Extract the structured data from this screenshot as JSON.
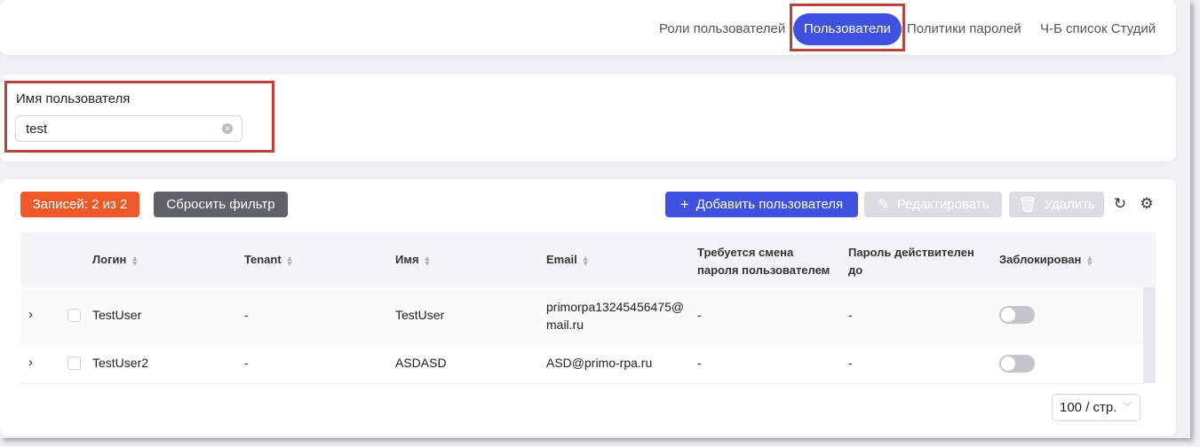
{
  "tabs": [
    {
      "label": "Роли пользователей",
      "active": false
    },
    {
      "label": "Пользователи",
      "active": true
    },
    {
      "label": "Политики паролей",
      "active": false
    },
    {
      "label": "Ч-Б список Студий",
      "active": false
    }
  ],
  "filter": {
    "label": "Имя пользователя",
    "value": "test"
  },
  "toolbar": {
    "count_label": "Записей: 2 из 2",
    "reset_label": "Сбросить фильтр",
    "add_label": "Добавить пользователя",
    "edit_label": "Редактировать",
    "delete_label": "Удалить",
    "add_icon": "plus-icon",
    "edit_icon": "pencil-icon",
    "delete_icon": "trash-icon",
    "refresh_icon": "refresh-icon",
    "settings_icon": "gear-icon"
  },
  "table": {
    "headers": {
      "login": "Логин",
      "tenant": "Tenant",
      "name": "Имя",
      "email": "Email",
      "pwd_change_1": "Требуется смена",
      "pwd_change_2": "пароля пользователем",
      "pwd_valid_1": "Пароль действителен",
      "pwd_valid_2": "до",
      "blocked": "Заблокирован"
    },
    "rows": [
      {
        "login": "TestUser",
        "tenant": "-",
        "name": "TestUser",
        "email_1": "primorpa13245456475@",
        "email_2": "mail.ru",
        "pwd_change": "-",
        "pwd_valid": "-",
        "blocked": false
      },
      {
        "login": "TestUser2",
        "tenant": "-",
        "name": "ASDASD",
        "email_1": "ASD@primo-rpa.ru",
        "email_2": "",
        "pwd_change": "-",
        "pwd_valid": "-",
        "blocked": false
      }
    ]
  },
  "pagination": {
    "page_size": "100 / стр."
  },
  "colors": {
    "accent": "#3f51e0",
    "count_badge": "#f05a2a",
    "reset_button": "#5f6268",
    "highlight": "#b8433a"
  }
}
